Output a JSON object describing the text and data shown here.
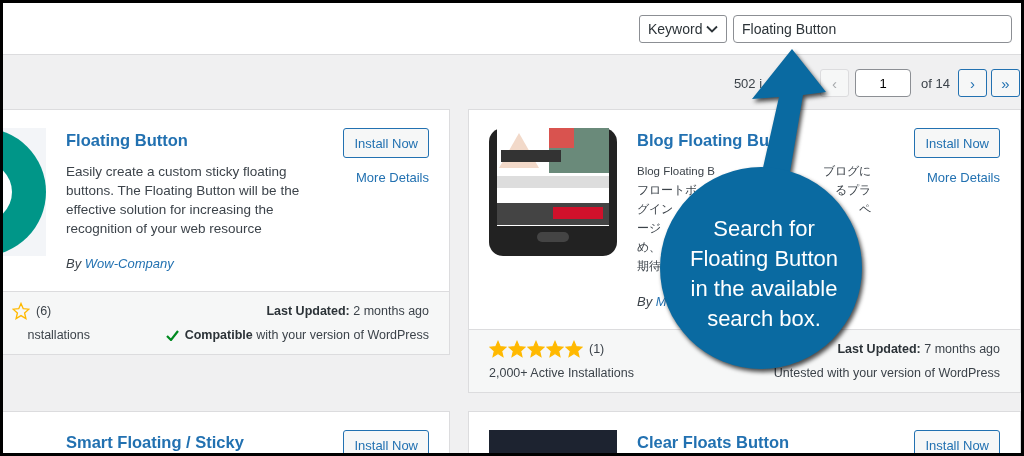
{
  "header": {
    "search_type": {
      "label": "Keyword"
    },
    "search": {
      "value": "Floating Button"
    }
  },
  "pagination": {
    "count": "502 i",
    "prev": {
      "label": "‹",
      "disabled": true
    },
    "page": "1",
    "total": "of 14",
    "next": {
      "label": "›",
      "disabled": false
    },
    "last": {
      "label": "»",
      "disabled": false
    }
  },
  "plugins": [
    {
      "kind": "circle",
      "title": "Floating Button",
      "description": "Easily create a custom sticky floating buttons. The Floating Button will be the effective solution for increasing the recognition of your web resource",
      "author_prefix": "By",
      "author": "Wow-Company",
      "install": "Install Now",
      "details": "More Details",
      "rating_count": "(6)",
      "installs": "nstallations",
      "updated_label": "Last Updated:",
      "updated": "2 months ago",
      "compatible": true,
      "compat_text": "**Compatible** with your version of WordPress"
    },
    {
      "kind": "phone",
      "title": "Blog Floating Bu",
      "description": [
        {
          "left": "Blog Floating B",
          "right": "ブログに"
        },
        {
          "left": "フロートボ",
          "right": "るプラ"
        },
        {
          "left": "グイン",
          "right": "ペ"
        },
        {
          "left": "ージ"
        },
        {
          "left": "め、"
        },
        {
          "left": "期待"
        }
      ],
      "author_prefix": "By",
      "author": "M",
      "install": "Install Now",
      "details": "More Details",
      "stars": 5,
      "rating_count": "(1)",
      "installs": "2,000+ Active Installations",
      "updated_label": "Last Updated:",
      "updated": "7 months ago",
      "compatible": false,
      "compat_text": "Untested with your version of WordPress"
    },
    {
      "kind": "blank",
      "title": "Smart Floating / Sticky",
      "install": "Install Now"
    },
    {
      "kind": "dark",
      "title": "Clear Floats Button",
      "install": "Install Now"
    }
  ],
  "callout": {
    "text": "Search for\nFloating Button\nin the available\nsearch box."
  }
}
